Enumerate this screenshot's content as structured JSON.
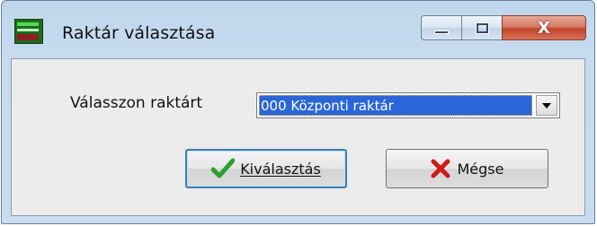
{
  "window": {
    "title": "Raktár választása",
    "app_icon": "warehouse-app-icon",
    "caption_buttons": [
      "minimize",
      "maximize",
      "close"
    ],
    "close_glyph": "X"
  },
  "form": {
    "label": "Válasszon raktárt",
    "warehouse_select": {
      "selected_value": "000 Központi raktár"
    }
  },
  "buttons": {
    "select": {
      "label": "Kiválasztás",
      "icon": "checkmark-icon",
      "color": "#2ca02c"
    },
    "cancel": {
      "label": "Mégse",
      "icon": "x-icon",
      "color": "#cc1b1b"
    }
  }
}
